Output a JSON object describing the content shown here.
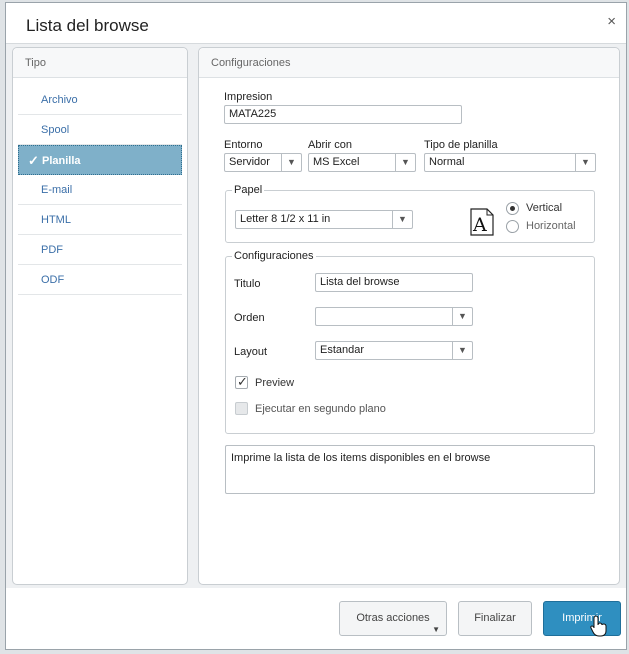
{
  "dialog": {
    "title": "Lista del browse",
    "close_glyph": "×"
  },
  "tipo": {
    "header": "Tipo",
    "items": [
      {
        "label": "Archivo",
        "selected": false
      },
      {
        "label": "Spool",
        "selected": false
      },
      {
        "label": "Planilla",
        "selected": true
      },
      {
        "label": "E-mail",
        "selected": false
      },
      {
        "label": "HTML",
        "selected": false
      },
      {
        "label": "PDF",
        "selected": false
      },
      {
        "label": "ODF",
        "selected": false
      }
    ]
  },
  "config": {
    "header": "Configuraciones",
    "impresion_label": "Impresion",
    "impresion_value": "MATA225",
    "entorno_label": "Entorno",
    "entorno_value": "Servidor",
    "abrir_label": "Abrir con",
    "abrir_value": "MS Excel",
    "tipo_planilla_label": "Tipo de planilla",
    "tipo_planilla_value": "Normal"
  },
  "papel": {
    "legend": "Papel",
    "size_value": "Letter 8 1/2 x 11 in",
    "orientation_options": [
      {
        "label": "Vertical",
        "selected": true
      },
      {
        "label": "Horizontal",
        "selected": false
      }
    ],
    "icon": "page-portrait-icon"
  },
  "configuraciones": {
    "legend": "Configuraciones",
    "titulo_label": "Titulo",
    "titulo_value": "Lista del browse",
    "orden_label": "Orden",
    "orden_value": "",
    "layout_label": "Layout",
    "layout_value": "Estandar",
    "preview_label": "Preview",
    "preview_checked": true,
    "ejecutar_label": "Ejecutar en segundo plano",
    "ejecutar_checked": false
  },
  "description": "Imprime la lista de los items disponibles en el browse",
  "footer": {
    "otras_acciones": "Otras acciones",
    "finalizar": "Finalizar",
    "imprimir": "Imprimir"
  },
  "colors": {
    "primary_button": "#2f8fc0",
    "selected_item": "#7fb0c9",
    "link_text": "#3b6fa8"
  }
}
